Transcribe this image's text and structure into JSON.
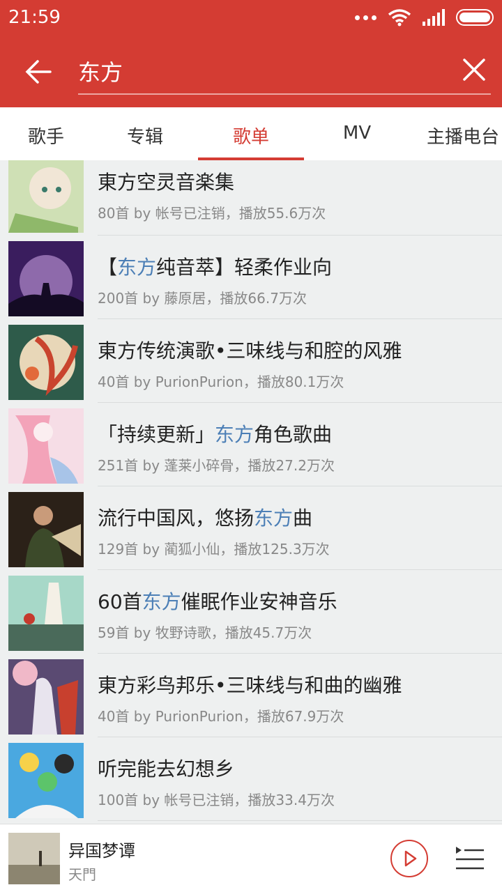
{
  "status": {
    "time": "21:59"
  },
  "search": {
    "query": "东方"
  },
  "tabs": [
    {
      "label": "歌手"
    },
    {
      "label": "专辑"
    },
    {
      "label": "歌单"
    },
    {
      "label": "MV"
    },
    {
      "label": "主播电台"
    }
  ],
  "playlists": [
    {
      "pre": "東方空灵音楽集",
      "hl": "",
      "post": "",
      "meta": "80首  by 帐号已注销，播放55.6万次"
    },
    {
      "pre": "【",
      "hl": "东方",
      "post": "纯音萃】轻柔作业向",
      "meta": "200首  by 藤原居，播放66.7万次"
    },
    {
      "pre": "東方传统演歌•三味线与和腔的风雅",
      "hl": "",
      "post": "",
      "meta": "40首  by PurionPurion，播放80.1万次"
    },
    {
      "pre": "「持续更新」",
      "hl": "东方",
      "post": "角色歌曲",
      "meta": "251首  by 蓬莱小碎骨，播放27.2万次"
    },
    {
      "pre": "流行中国风，悠扬",
      "hl": "东方",
      "post": "曲",
      "meta": "129首  by 蔺狐小仙，播放125.3万次"
    },
    {
      "pre": "60首",
      "hl": "东方",
      "post": "催眠作业安神音乐",
      "meta": "59首  by 牧野诗歌，播放45.7万次"
    },
    {
      "pre": "東方彩鸟邦乐•三味线与和曲的幽雅",
      "hl": "",
      "post": "",
      "meta": "40首  by PurionPurion，播放67.9万次"
    },
    {
      "pre": "听完能去幻想乡",
      "hl": "",
      "post": "",
      "meta": "100首  by 帐号已注销，播放33.4万次"
    }
  ],
  "player": {
    "song": "异国梦谭",
    "artist": "天門"
  },
  "colors": {
    "brand": "#d43c33",
    "highlight": "#4c7fb6"
  }
}
